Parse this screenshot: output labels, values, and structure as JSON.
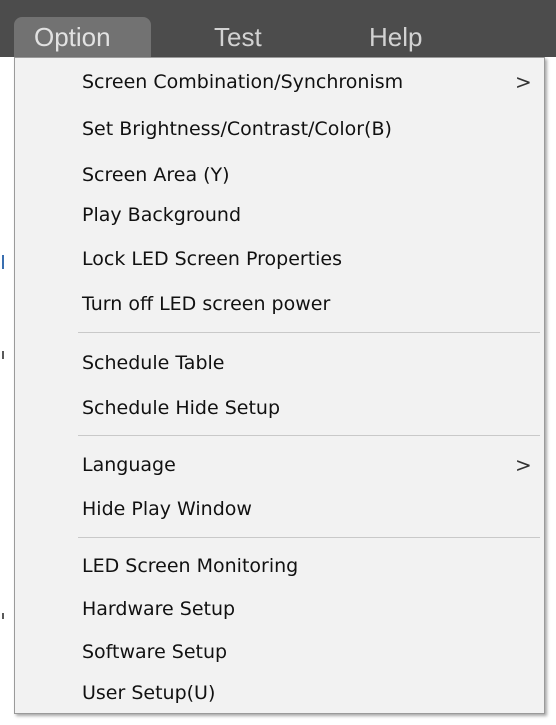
{
  "menubar": {
    "items": [
      {
        "label": "Option",
        "active": true
      },
      {
        "label": "Test",
        "active": false
      },
      {
        "label": "Help",
        "active": false
      }
    ]
  },
  "dropdown": {
    "groups": [
      [
        {
          "label": "Screen Combination/Synchronism",
          "has_submenu": true
        },
        {
          "label": "Set Brightness/Contrast/Color(B)",
          "has_submenu": false
        },
        {
          "label": "Screen Area (Y)",
          "has_submenu": false
        },
        {
          "label": "Play Background",
          "has_submenu": false
        },
        {
          "label": "Lock LED Screen Properties",
          "has_submenu": false
        },
        {
          "label": "Turn off LED screen power",
          "has_submenu": false
        }
      ],
      [
        {
          "label": "Schedule Table",
          "has_submenu": false
        },
        {
          "label": "Schedule Hide Setup",
          "has_submenu": false
        }
      ],
      [
        {
          "label": "Language",
          "has_submenu": true
        },
        {
          "label": "Hide Play Window",
          "has_submenu": false
        }
      ],
      [
        {
          "label": "LED Screen Monitoring",
          "has_submenu": false
        },
        {
          "label": "Hardware Setup",
          "has_submenu": false
        },
        {
          "label": "Software Setup",
          "has_submenu": false
        },
        {
          "label": "User Setup(U)",
          "has_submenu": false
        }
      ]
    ],
    "submenu_glyph": ">"
  },
  "colors": {
    "menubar_bg": "#4c4c4c",
    "menubar_active_bg": "#727272",
    "menubar_text": "#d2d2d2",
    "dropdown_bg": "#f2f2f2",
    "separator": "#c9c9c9"
  }
}
